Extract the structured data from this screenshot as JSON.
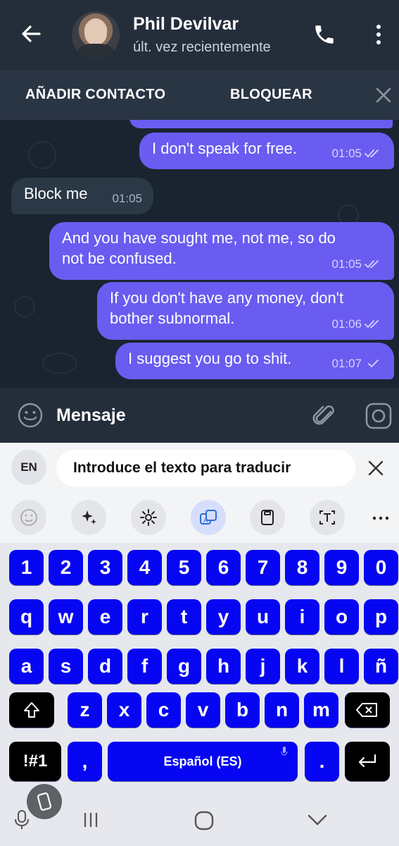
{
  "header": {
    "contact_name": "Phil Devilvar",
    "status": "últ. vez recientemente",
    "back_icon": "arrow-left-icon",
    "call_icon": "phone-icon",
    "more_icon": "more-vertical-icon"
  },
  "action_bar": {
    "add_contact": "AÑADIR CONTACTO",
    "block": "BLOQUEAR",
    "close_icon": "close-icon"
  },
  "messages": [
    {
      "direction": "out",
      "text": "I don't speak for free.",
      "time": "01:05",
      "status": "read"
    },
    {
      "direction": "in",
      "text": "Block me",
      "time": "01:05"
    },
    {
      "direction": "out",
      "text": "And you have sought me, not me, so do not be confused.",
      "time": "01:05",
      "status": "read"
    },
    {
      "direction": "out",
      "text": "If you don't have any money, don't bother subnormal.",
      "time": "01:06",
      "status": "read"
    },
    {
      "direction": "out",
      "text": "I suggest you go to shit.",
      "time": "01:07",
      "status": "sent"
    }
  ],
  "input_bar": {
    "placeholder": "Mensaje"
  },
  "keyboard": {
    "translate": {
      "lang": "EN",
      "placeholder": "Introduce el texto para traducir"
    },
    "rows": {
      "numbers": [
        "1",
        "2",
        "3",
        "4",
        "5",
        "6",
        "7",
        "8",
        "9",
        "0"
      ],
      "row1": [
        "q",
        "w",
        "e",
        "r",
        "t",
        "y",
        "u",
        "i",
        "o",
        "p"
      ],
      "row2": [
        "a",
        "s",
        "d",
        "f",
        "g",
        "h",
        "j",
        "k",
        "l",
        "ñ"
      ],
      "row3": [
        "z",
        "x",
        "c",
        "v",
        "b",
        "n",
        "m"
      ]
    },
    "symbols_key": "!#1",
    "comma_key": ",",
    "space_label": "Español (ES)",
    "period_key": ".",
    "colors": {
      "key": "#0606f2",
      "dark_key": "#000000",
      "bubble_out": "#6a5cf0"
    }
  }
}
